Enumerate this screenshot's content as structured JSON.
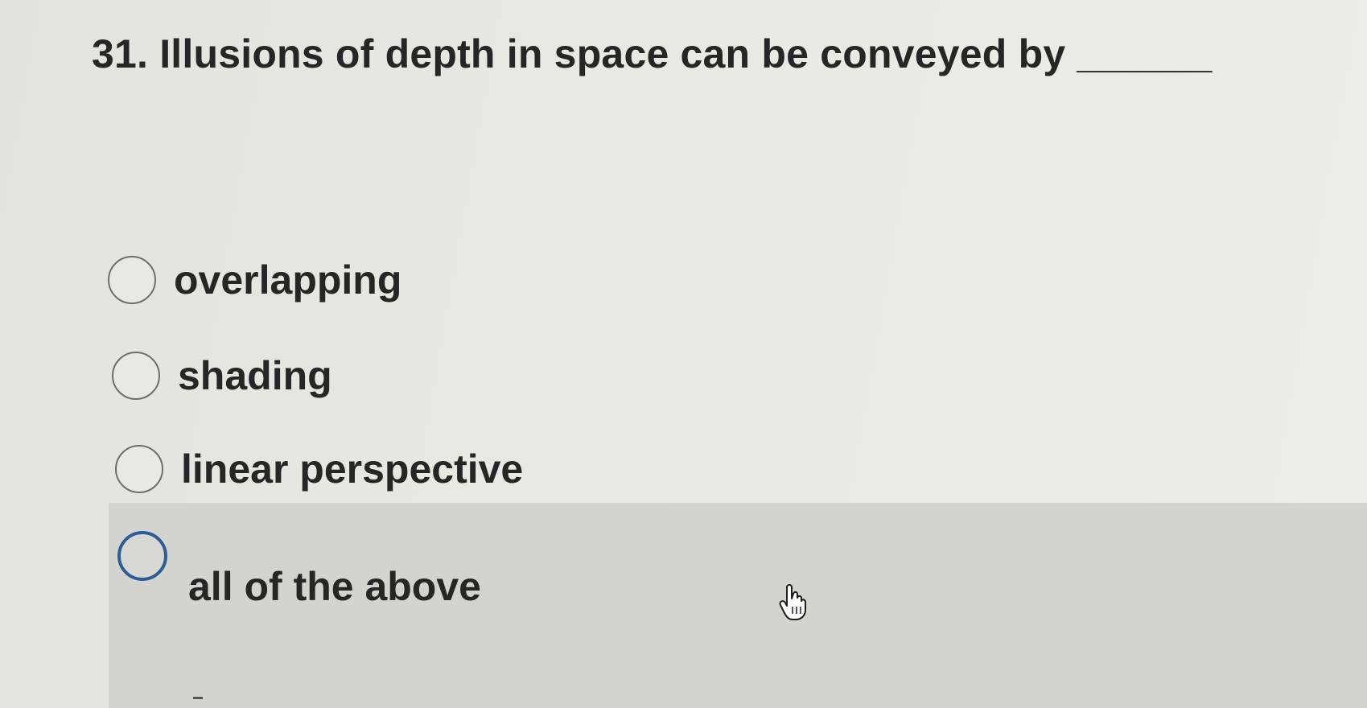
{
  "question": {
    "text": "31. Illusions of depth in space can be conveyed by ______"
  },
  "options": [
    {
      "label": "overlapping",
      "selected": false
    },
    {
      "label": "shading",
      "selected": false
    },
    {
      "label": "linear perspective",
      "selected": false
    },
    {
      "label": "all of the above",
      "selected": false,
      "hovered": true
    }
  ],
  "colors": {
    "hover_radio_border": "#2d5d96",
    "radio_border": "#6d6d6d",
    "hover_row_bg": "#d3d3cf"
  },
  "icons": {
    "cursor": "hand-pointer-icon"
  }
}
